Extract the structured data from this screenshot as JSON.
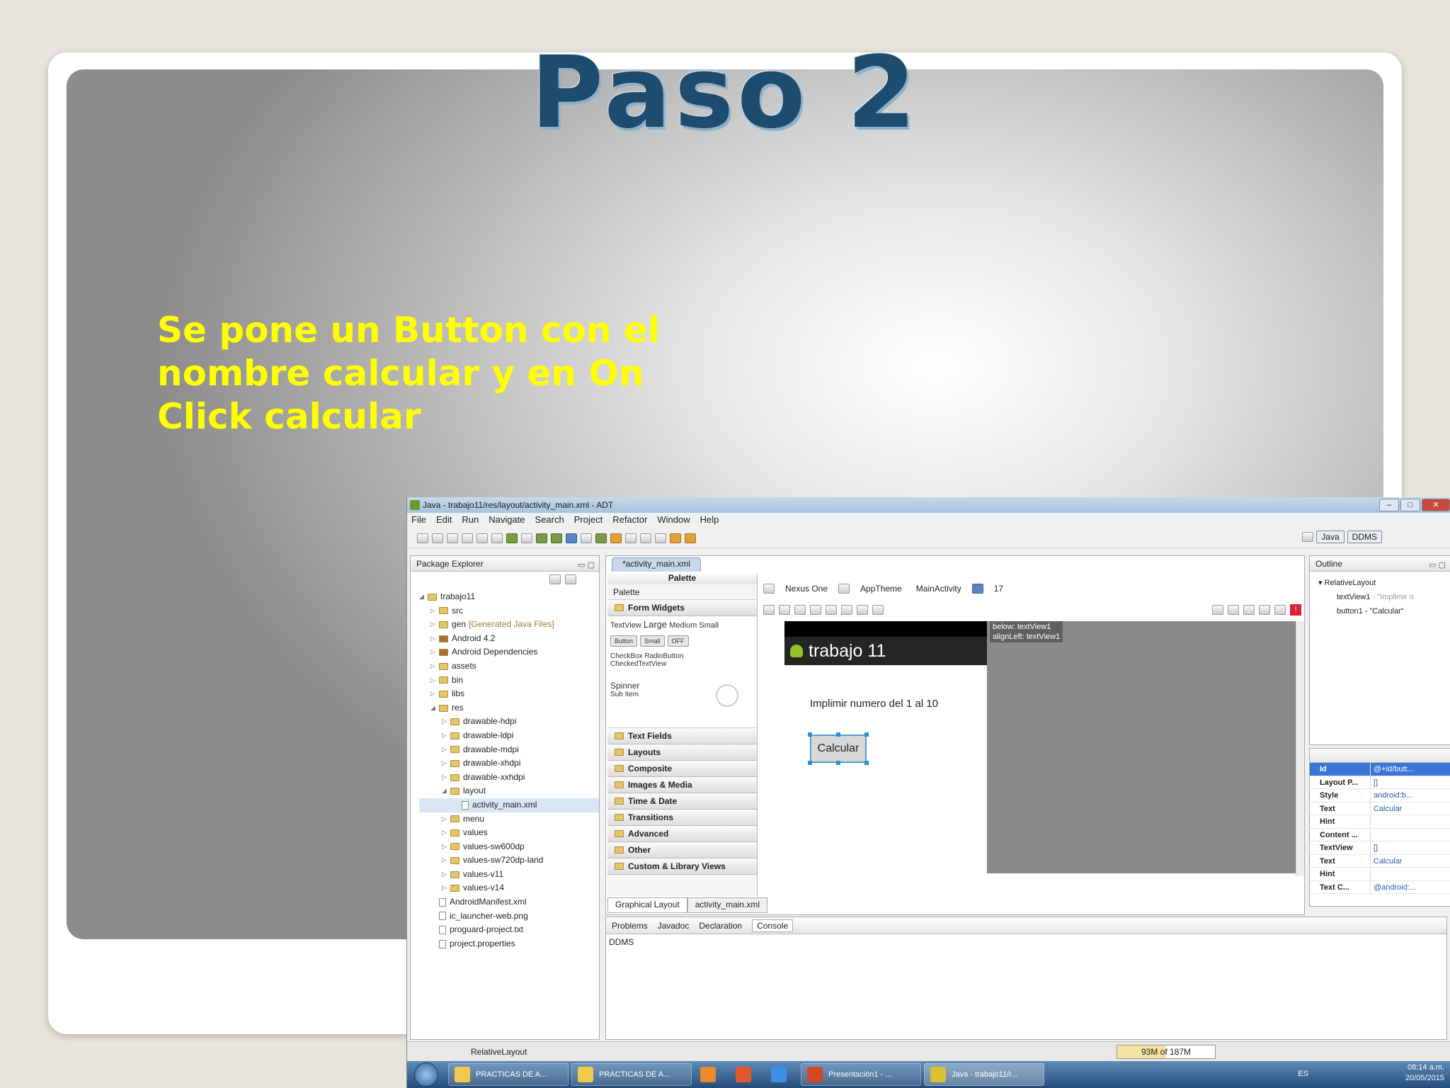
{
  "slide": {
    "title": "Paso 2",
    "text_lines": [
      "Se pone un Button con el",
      "nombre calcular y en On",
      "Click calcular"
    ]
  },
  "window": {
    "title": "Java - trabajo11/res/layout/activity_main.xml - ADT",
    "controls": [
      "–",
      "□",
      "✕"
    ]
  },
  "menu": [
    "File",
    "Edit",
    "Run",
    "Navigate",
    "Search",
    "Project",
    "Refactor",
    "Window",
    "Help"
  ],
  "perspectives": [
    "Java",
    "DDMS"
  ],
  "package_explorer": {
    "title": "Package Explorer",
    "items": [
      {
        "label": "trabajo11",
        "level": 0,
        "icon": "project-icon"
      },
      {
        "label": "src",
        "level": 1,
        "icon": "folder-icon"
      },
      {
        "label": "gen",
        "note": "[Generated Java Files]",
        "level": 1,
        "icon": "folder-icon"
      },
      {
        "label": "Android 4.2",
        "level": 1,
        "icon": "library-icon"
      },
      {
        "label": "Android Dependencies",
        "level": 1,
        "icon": "library-icon"
      },
      {
        "label": "assets",
        "level": 1,
        "icon": "folder-icon"
      },
      {
        "label": "bin",
        "level": 1,
        "icon": "folder-icon"
      },
      {
        "label": "libs",
        "level": 1,
        "icon": "folder-icon"
      },
      {
        "label": "res",
        "level": 1,
        "icon": "folder-icon"
      },
      {
        "label": "drawable-hdpi",
        "level": 2,
        "icon": "folder-icon"
      },
      {
        "label": "drawable-ldpi",
        "level": 2,
        "icon": "folder-icon"
      },
      {
        "label": "drawable-mdpi",
        "level": 2,
        "icon": "folder-icon"
      },
      {
        "label": "drawable-xhdpi",
        "level": 2,
        "icon": "folder-icon"
      },
      {
        "label": "drawable-xxhdpi",
        "level": 2,
        "icon": "folder-icon"
      },
      {
        "label": "layout",
        "level": 2,
        "icon": "folder-icon"
      },
      {
        "label": "activity_main.xml",
        "level": 3,
        "icon": "xml-file-icon"
      },
      {
        "label": "menu",
        "level": 2,
        "icon": "folder-icon"
      },
      {
        "label": "values",
        "level": 2,
        "icon": "folder-icon"
      },
      {
        "label": "values-sw600dp",
        "level": 2,
        "icon": "folder-icon"
      },
      {
        "label": "values-sw720dp-land",
        "level": 2,
        "icon": "folder-icon"
      },
      {
        "label": "values-v11",
        "level": 2,
        "icon": "folder-icon"
      },
      {
        "label": "values-v14",
        "level": 2,
        "icon": "folder-icon"
      },
      {
        "label": "AndroidManifest.xml",
        "level": 1,
        "icon": "xml-file-icon"
      },
      {
        "label": "ic_launcher-web.png",
        "level": 1,
        "icon": "image-file-icon"
      },
      {
        "label": "proguard-project.txt",
        "level": 1,
        "icon": "text-file-icon"
      },
      {
        "label": "project.properties",
        "level": 1,
        "icon": "text-file-icon"
      }
    ]
  },
  "editor": {
    "tab": "*activity_main.xml",
    "palette": {
      "header": "Palette",
      "dropdown": "Palette",
      "categories": [
        "Form Widgets",
        "Text Fields",
        "Layouts",
        "Composite",
        "Images & Media",
        "Time & Date",
        "Transitions",
        "Advanced",
        "Other",
        "Custom & Library Views"
      ],
      "textview_row": {
        "prefix": "TextView",
        "large": "Large",
        "medium": "Medium",
        "small": "Small"
      },
      "form_buttons": [
        "Button",
        "Small",
        "OFF"
      ],
      "checks": "CheckBox  RadioButton",
      "checked_textview": "CheckedTextView",
      "spinner": "Spinner",
      "spinner_sub": "Sub Item"
    },
    "config_toolbar": [
      "Nexus One",
      "AppTheme",
      "MainActivity",
      "17"
    ],
    "device_screen": {
      "app_title": "trabajo 11",
      "text": "Implimir numero del 1 al 10",
      "button": "Calcular",
      "hint_line1": "below: textView1",
      "hint_line2": "alignLeft: textView1"
    },
    "bottom_tabs": [
      "Graphical Layout",
      "activity_main.xml"
    ]
  },
  "outline": {
    "title": "Outline",
    "items": [
      {
        "label": "RelativeLayout",
        "detail": ""
      },
      {
        "label": "textView1",
        "detail": " - \"Implimir n"
      },
      {
        "label": "button1",
        "detail": " - \"Calcular\""
      }
    ]
  },
  "properties": [
    {
      "key": "Id",
      "value": "@+id/butt...",
      "selected": true
    },
    {
      "key": "Layout P...",
      "value": "[]"
    },
    {
      "key": "Style",
      "value": "android:b..."
    },
    {
      "key": "Text",
      "value": "Calcular"
    },
    {
      "key": "Hint",
      "value": ""
    },
    {
      "key": "Content ...",
      "value": ""
    },
    {
      "key": "TextView",
      "value": "[]"
    },
    {
      "key": "Text",
      "value": "Calcular"
    },
    {
      "key": "Hint",
      "value": ""
    },
    {
      "key": "Text C...",
      "value": "@android:..."
    }
  ],
  "console": {
    "tabs": [
      "Problems",
      "Javadoc",
      "Declaration",
      "Console"
    ],
    "body": "DDMS"
  },
  "statusbar": {
    "selection": "RelativeLayout",
    "heap": "93M of 187M",
    "heap_used_fraction": 0.5
  },
  "taskbar": {
    "items": [
      {
        "label": "PRACTICAS DE A...",
        "icon_color": "#f2c94c"
      },
      {
        "label": "PRACTICAS DE A...",
        "icon_color": "#f2c94c"
      },
      {
        "label": "",
        "icon_color": "#e98a2c"
      },
      {
        "label": "",
        "icon_color": "#e2562b"
      },
      {
        "label": "",
        "icon_color": "#3f8ee5"
      },
      {
        "label": "Presentación1 - ...",
        "icon_color": "#d24726"
      },
      {
        "label": "Java - trabajo11/r...",
        "icon_color": "#d9c035"
      }
    ],
    "lang": "ES",
    "time": "08:14 a.m.",
    "date": "20/05/2015"
  }
}
